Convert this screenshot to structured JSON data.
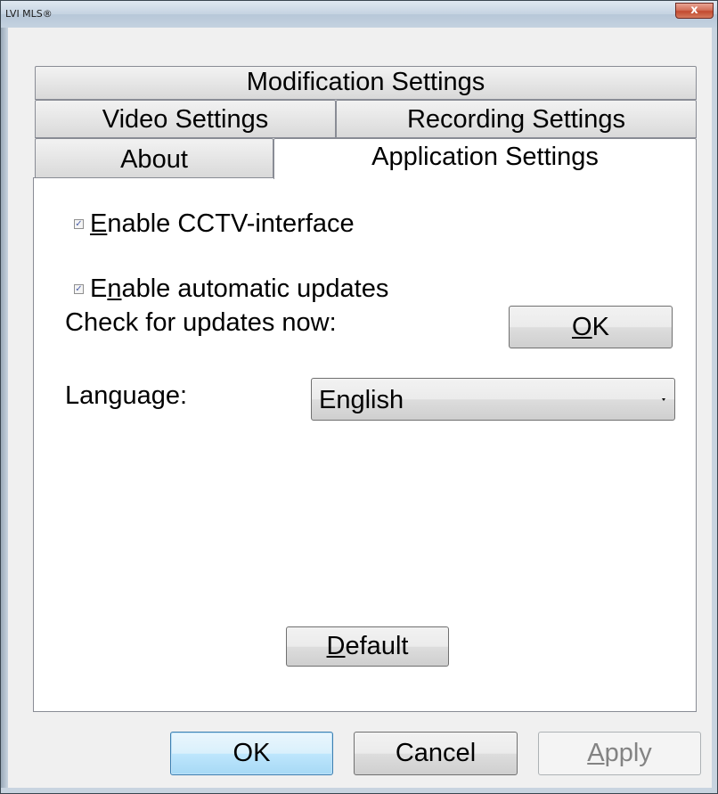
{
  "window": {
    "title": "LVI MLS®",
    "close_glyph": "x"
  },
  "tabs": {
    "row1": [
      {
        "label": "Modification Settings"
      }
    ],
    "row2": [
      {
        "label": "Video Settings"
      },
      {
        "label": "Recording Settings"
      }
    ],
    "row3": [
      {
        "label": "About"
      },
      {
        "label": "Application Settings",
        "selected": true
      }
    ]
  },
  "panel": {
    "cctv": {
      "label_prefix": "",
      "label_mnemonic": "E",
      "label_rest": "nable CCTV-interface",
      "checked": true
    },
    "updates": {
      "label_prefix": "E",
      "label_mnemonic": "n",
      "label_rest": "able automatic updates",
      "checked": true
    },
    "check_updates_label": "Check for updates now:",
    "check_ok_button": {
      "mnemonic": "O",
      "rest": "K"
    },
    "language_label": "Language:",
    "language_value": "English",
    "default_button": {
      "mnemonic": "D",
      "rest": "efault"
    }
  },
  "footer": {
    "ok_label": "OK",
    "cancel_label": "Cancel",
    "apply_mnemonic": "A",
    "apply_rest": "pply"
  },
  "colors": {
    "close_button": "#c24a2f",
    "default_button_border": "#3c7fb1"
  },
  "icons": {
    "checkbox_check": "check-icon",
    "dropdown": "chevron-down-icon",
    "close": "close-icon"
  }
}
